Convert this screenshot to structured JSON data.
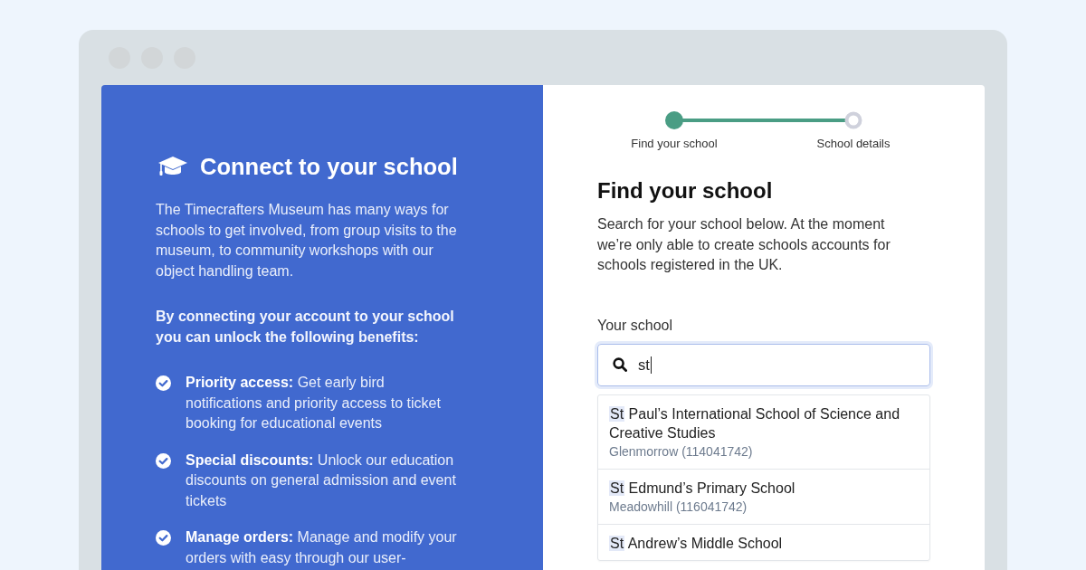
{
  "intro": {
    "title": "Connect to your school",
    "description": "The Timecrafters Museum has many ways for schools to get involved, from group visits to the museum, to community workshops with our object handling team.",
    "benefits_intro": "By connecting your account to your school you can unlock the following benefits:",
    "benefits": [
      "**Priority access:** Get early bird notifications and priority access to ticket booking for educational events",
      "**Special discounts:** Unlock our education discounts on general admission and event tickets",
      "**Manage orders:** Manage and modify your orders with easy through our user-"
    ]
  },
  "stepper": {
    "steps": [
      {
        "label": "Find your school",
        "active": true
      },
      {
        "label": "School details",
        "active": false
      }
    ]
  },
  "form": {
    "heading": "Find your school",
    "description": "Search for your school below. At the moment we’re only able to create schools accounts for schools registered in the UK.",
    "field_label": "Your school",
    "search": {
      "value": "st",
      "focused": true
    },
    "results": [
      {
        "match": "St",
        "name": "Paul’s International School of Science and Creative Studies",
        "location": "Glenmorrow (114041742)"
      },
      {
        "match": "St",
        "name": "Edmund’s Primary School",
        "location": "Meadowhill (116041742)"
      },
      {
        "match": "St",
        "name": "Andrew’s Middle School"
      }
    ]
  }
}
